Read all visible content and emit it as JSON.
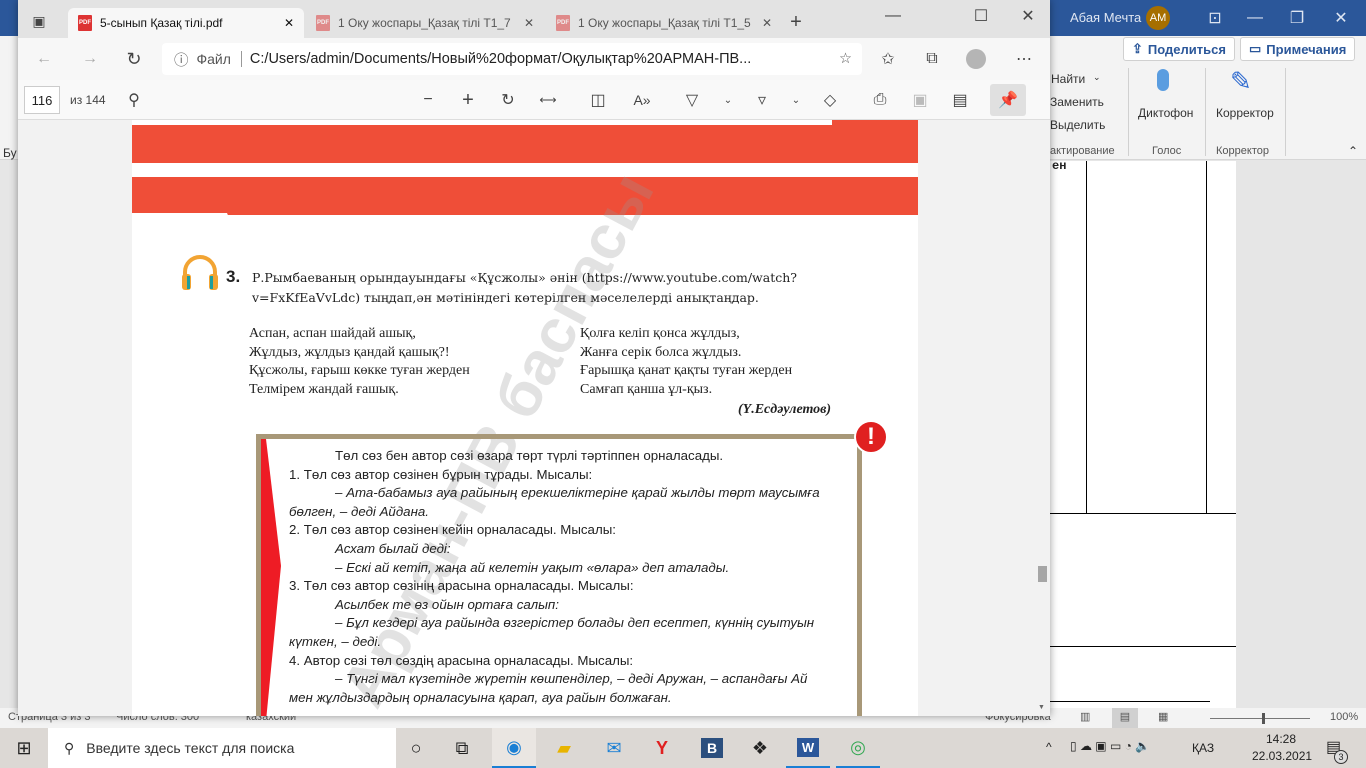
{
  "word": {
    "user_name": "Абая Мечта",
    "user_initials": "АМ",
    "share_label": "Поделиться",
    "comments_label": "Примечания",
    "find_label": "Найти",
    "replace_label": "Заменить",
    "select_label": "Выделить",
    "editing_group": "актирование",
    "dictate_label": "Диктофон",
    "voice_group": "Голос",
    "editor_label": "Корректор",
    "editor_group": "Корректор",
    "left_cut": "Бу",
    "doc_cut": "ен",
    "status": {
      "page": "Страница 3 из 3",
      "words": "Число слов: 300",
      "language": "казахский",
      "focus": "Фокусировка",
      "zoom": "100%"
    }
  },
  "edge": {
    "tabs": [
      {
        "label": "5-сынып Қазақ тілі.pdf",
        "active": true
      },
      {
        "label": "1 Оку жоспары_Қазақ тілі Т1_7",
        "active": false
      },
      {
        "label": "1 Оку жоспары_Қазақ тілі Т1_5",
        "active": false
      }
    ],
    "address": {
      "prefix": "Файл",
      "url": "C:/Users/admin/Documents/Новый%20формат/Оқулықтар%20АРМАН-ПВ..."
    },
    "pdf": {
      "current_page": "116",
      "total_pages": "из 144"
    }
  },
  "document": {
    "watermark": "Арман-ПВ баспасы",
    "task_number": "3.",
    "task_text_1": "Р.Рымбаеваның орындауындағы «Құсжолы» әнін (https://www.youtube.com/watch?",
    "task_text_2": "v=FxKfEaVvLdc) тыңдап,ән мәтініндегі көтерілген мәселелерді анықтаңдар.",
    "poem_left": [
      "Аспан, аспан шайдай ашық,",
      "Жұлдыз, жұлдыз қандай қашық?!",
      "Құсжолы, ғарыш көкке туған жерден",
      "Телмірем жандай ғашық."
    ],
    "poem_right": [
      "Қолға келіп қонса жұлдыз,",
      "Жанға серік болса жұлдыз.",
      "Ғарышқа қанат қақты туған жерден",
      "Самғап қанша ұл-қыз."
    ],
    "poem_author": "(Ү.Есдәулетов)",
    "rule_lines": [
      {
        "text": "Төл сөз бен автор сөзі өзара төрт түрлі тәртіппен орналасады.",
        "style": "indent"
      },
      {
        "text": "1.  Төл сөз автор сөзінен бұрын тұрады. Мысалы:",
        "style": "num"
      },
      {
        "text": "– Ата-бабамыз ауа райының ерекшеліктеріне қарай жылды төрт маусымға",
        "style": "indent it"
      },
      {
        "text": "бөлген, – деді Айдана.",
        "style": "num it"
      },
      {
        "text": "2.  Төл сөз автор сөзінен кейін орналасады. Мысалы:",
        "style": "num"
      },
      {
        "text": "Асхат былай деді:",
        "style": "indent it"
      },
      {
        "text": "– Ескі ай кетіп, жаңа ай келетін уақыт «өлара» деп аталады.",
        "style": "indent it"
      },
      {
        "text": "3.  Төл сөз автор сөзінің арасына орналасады. Мысалы:",
        "style": "num"
      },
      {
        "text": "Асылбек те өз ойын ортаға салып:",
        "style": "indent it"
      },
      {
        "text": "– Бұл кездері ауа райында өзгерістер болады деп есептеп, күннің суытуын",
        "style": "indent it"
      },
      {
        "text": "күткен, – деді.",
        "style": "num it"
      },
      {
        "text": "4.  Автор сөзі төл сөздің арасына орналасады. Мысалы:",
        "style": "num"
      },
      {
        "text": "– Түнгі мал күзетінде жүретін көшпенділер, – деді Аружан, – аспандағы Ай",
        "style": "indent it"
      },
      {
        "text": "мен жұлдыздардың орналасуына қарап, ауа райын болжаған.",
        "style": "num it"
      }
    ]
  },
  "taskbar": {
    "search_placeholder": "Введите здесь текст для поиска",
    "time": "14:28",
    "date": "22.03.2021",
    "lang": "ҚАЗ",
    "notif_count": "3"
  },
  "colors": {
    "word_blue": "#2b579a",
    "band_red": "#ef4e38",
    "box_border": "#a89878",
    "alert_red": "#e02020"
  }
}
